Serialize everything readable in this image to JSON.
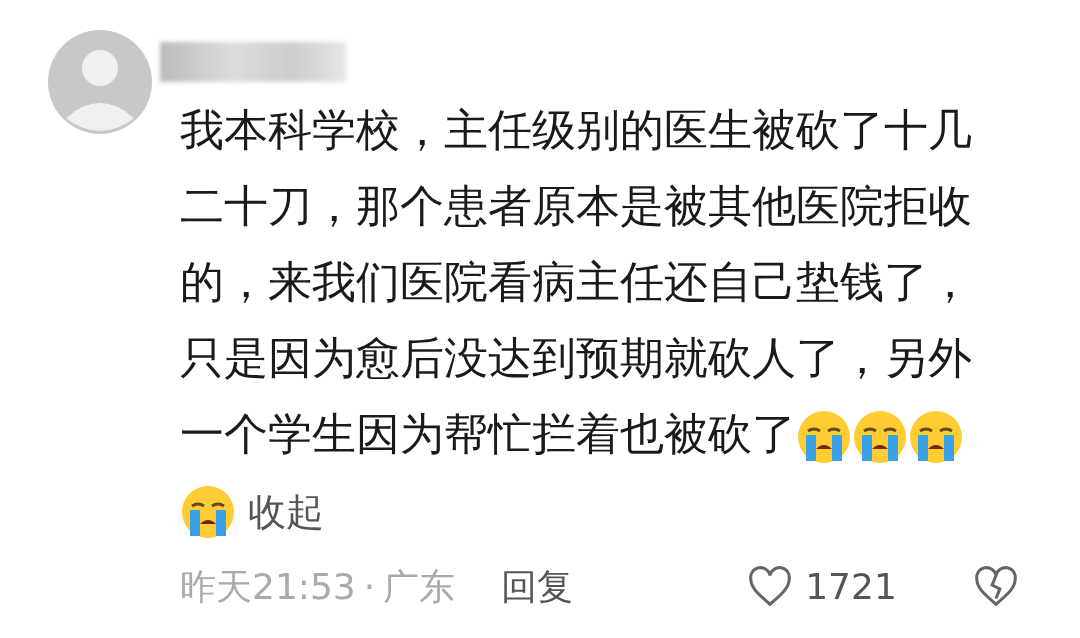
{
  "comment": {
    "body_lines": [
      "我本科学校，主任级别的医生被砍了十几",
      "二十刀，那个患者原本是被其他医院拒收",
      "的，来我们医院看病主任还自己垫钱了，",
      "只是因为愈后没达到预期就砍人了，另外",
      "一个学生因为帮忙拦着也被砍了"
    ],
    "collapse_link": "收起",
    "time": "昨天21:53",
    "separator": "·",
    "location": "广东",
    "reply": "回复",
    "likes": "1721",
    "liked": false
  }
}
